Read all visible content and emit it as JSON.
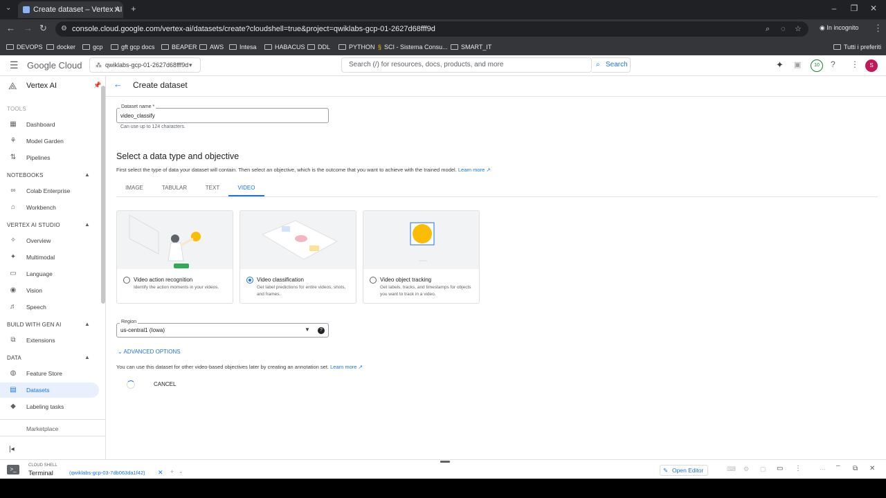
{
  "browser": {
    "tab_title": "Create dataset – Vertex AI – qwi",
    "url": "console.cloud.google.com/vertex-ai/datasets/create?cloudshell=true&project=qwiklabs-gcp-01-2627d68fff9d",
    "incognito_label": "In incognito",
    "bookmarks": [
      "DEVOPS",
      "docker",
      "gcp",
      "gft gcp docs",
      "BEAPER",
      "AWS",
      "Intesa",
      "HABACUS",
      "DDL",
      "PYTHON",
      "SCI - Sistema Consu...",
      "SMART_IT"
    ],
    "all_bookmarks": "Tutti i preferiti"
  },
  "header": {
    "logo": "Google Cloud",
    "project": "qwiklabs-gcp-01-2627d68fff9d",
    "search_placeholder": "Search (/) for resources, docs, products, and more",
    "search_button": "Search",
    "notification_count": "10",
    "avatar_letter": "S"
  },
  "sidebar": {
    "product": "Vertex AI",
    "sections": {
      "tools": "TOOLS",
      "notebooks": "NOTEBOOKS",
      "studio": "VERTEX AI STUDIO",
      "build": "BUILD WITH GEN AI",
      "data": "DATA"
    },
    "items": {
      "dashboard": "Dashboard",
      "model_garden": "Model Garden",
      "pipelines": "Pipelines",
      "colab": "Colab Enterprise",
      "workbench": "Workbench",
      "overview": "Overview",
      "multimodal": "Multimodal",
      "language": "Language",
      "vision": "Vision",
      "speech": "Speech",
      "extensions": "Extensions",
      "feature_store": "Feature Store",
      "datasets": "Datasets",
      "labeling": "Labeling tasks",
      "marketplace": "Marketplace"
    }
  },
  "main": {
    "title": "Create dataset",
    "dataset_name_label": "Dataset name *",
    "dataset_name_value": "video_classify",
    "dataset_name_hint": "Can use up to 124 characters.",
    "section_title": "Select a data type and objective",
    "section_desc": "First select the type of data your dataset will contain. Then select an objective, which is the outcome that you want to achieve with the trained model.",
    "learn_more": "Learn more",
    "tabs": [
      "IMAGE",
      "TABULAR",
      "TEXT",
      "VIDEO"
    ],
    "cards": [
      {
        "title": "Video action recognition",
        "desc": "Identify the action moments in your videos.",
        "selected": false
      },
      {
        "title": "Video classification",
        "desc": "Get label predictions for entire videos, shots, and frames.",
        "selected": true
      },
      {
        "title": "Video object tracking",
        "desc": "Get labels, tracks, and timestamps for objects you want to track in a video.",
        "selected": false
      }
    ],
    "region_label": "Region",
    "region_value": "us-central1 (Iowa)",
    "advanced": "ADVANCED OPTIONS",
    "annotation_note": "You can use this dataset for other video-based objectives later by creating an annotation set.",
    "cancel": "CANCEL"
  },
  "shell": {
    "label_top": "CLOUD SHELL",
    "label_bottom": "Terminal",
    "session": "(qwiklabs-gcp-03-7db063da1f42)",
    "open_editor": "Open Editor"
  },
  "colors": {
    "accent": "#1a73e8",
    "avatar": "#c2185b"
  }
}
